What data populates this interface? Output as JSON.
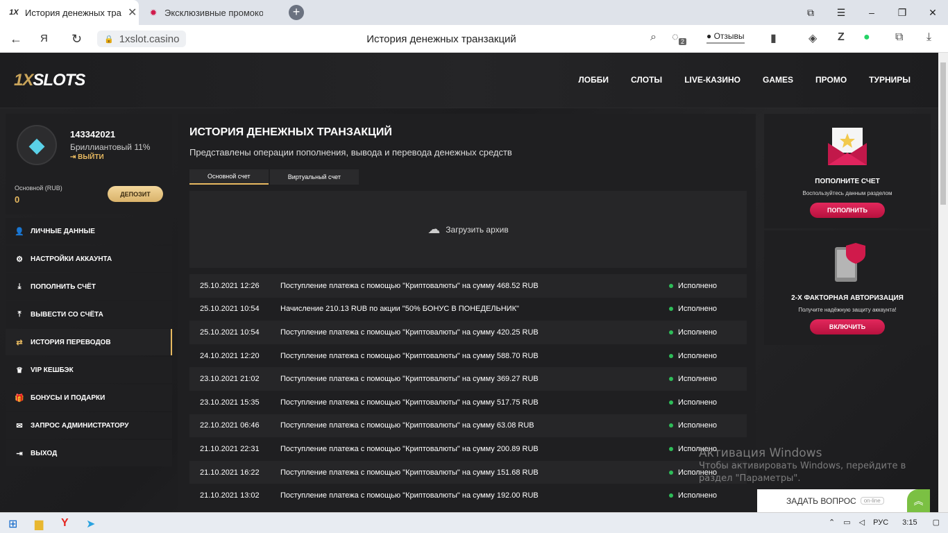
{
  "browser": {
    "tabs": [
      {
        "title": "История денежных тра",
        "favicon": "1X"
      },
      {
        "title": "Эксклюзивные промокод",
        "favicon": "✹"
      }
    ],
    "new_tab": "+",
    "url": "1xslot.casino",
    "page_title": "История денежных транзакций",
    "reviews_label": "Отзывы",
    "badge_count": "2"
  },
  "site": {
    "logo_prefix": "1X",
    "logo_rest": "SLOTS",
    "nav": [
      "ЛОББИ",
      "СЛОТЫ",
      "LIVE-КАЗИНО",
      "GAMES",
      "ПРОМО",
      "ТУРНИРЫ"
    ]
  },
  "profile": {
    "user_id": "143342021",
    "level": "Бриллиантовый 11%",
    "logout": "ВЫЙТИ",
    "balance_label": "Основной (RUB)",
    "balance_value": "0",
    "deposit_button": "ДЕПОЗИТ"
  },
  "menu": [
    {
      "label": "ЛИЧНЫЕ ДАННЫЕ",
      "icon": "user-icon",
      "glyph": "👤"
    },
    {
      "label": "НАСТРОЙКИ АККАУНТА",
      "icon": "gear-icon",
      "glyph": "⚙"
    },
    {
      "label": "ПОПОЛНИТЬ СЧЁТ",
      "icon": "download-icon",
      "glyph": "⤓"
    },
    {
      "label": "ВЫВЕСТИ СО СЧЁТА",
      "icon": "upload-icon",
      "glyph": "⤒"
    },
    {
      "label": "ИСТОРИЯ ПЕРЕВОДОВ",
      "icon": "transfer-icon",
      "glyph": "⇄"
    },
    {
      "label": "VIP КЕШБЭК",
      "icon": "crown-icon",
      "glyph": "♛"
    },
    {
      "label": "БОНУСЫ И ПОДАРКИ",
      "icon": "gift-icon",
      "glyph": "🎁"
    },
    {
      "label": "ЗАПРОС АДМИНИСТРАТОРУ",
      "icon": "mail-icon",
      "glyph": "✉"
    },
    {
      "label": "ВЫХОД",
      "icon": "exit-icon",
      "glyph": "⇥"
    }
  ],
  "content": {
    "title": "ИСТОРИЯ ДЕНЕЖНЫХ ТРАНЗАКЦИЙ",
    "subtitle": "Представлены операции пополнения, вывода и перевода денежных средств",
    "tabs": [
      "Основной счет",
      "Виртуальный счет"
    ],
    "archive_label": "Загрузить архив",
    "transactions": [
      {
        "date": "25.10.2021 12:26",
        "desc": "Поступление платежа с помощью \"Криптовалюты\" на сумму 468.52 RUB",
        "status": "Исполнено"
      },
      {
        "date": "25.10.2021 10:54",
        "desc": "Начисление 210.13 RUB по акции \"50% БОНУС В ПОНЕДЕЛЬНИК\"",
        "status": "Исполнено"
      },
      {
        "date": "25.10.2021 10:54",
        "desc": "Поступление платежа с помощью \"Криптовалюты\" на сумму 420.25 RUB",
        "status": "Исполнено"
      },
      {
        "date": "24.10.2021 12:20",
        "desc": "Поступление платежа с помощью \"Криптовалюты\" на сумму 588.70 RUB",
        "status": "Исполнено"
      },
      {
        "date": "23.10.2021 21:02",
        "desc": "Поступление платежа с помощью \"Криптовалюты\" на сумму 369.27 RUB",
        "status": "Исполнено"
      },
      {
        "date": "23.10.2021 15:35",
        "desc": "Поступление платежа с помощью \"Криптовалюты\" на сумму 517.75 RUB",
        "status": "Исполнено"
      },
      {
        "date": "22.10.2021 06:46",
        "desc": "Поступление платежа с помощью \"Криптовалюты\" на сумму 63.08 RUB",
        "status": "Исполнено"
      },
      {
        "date": "21.10.2021 22:31",
        "desc": "Поступление платежа с помощью \"Криптовалюты\" на сумму 200.89 RUB",
        "status": "Исполнено"
      },
      {
        "date": "21.10.2021 16:22",
        "desc": "Поступление платежа с помощью \"Криптовалюты\" на сумму 151.68 RUB",
        "status": "Исполнено"
      },
      {
        "date": "21.10.2021 13:02",
        "desc": "Поступление платежа с помощью \"Криптовалюты\" на сумму 192.00 RUB",
        "status": "Исполнено"
      }
    ]
  },
  "promos": [
    {
      "title": "ПОПОЛНИТЕ СЧЕТ",
      "subtitle": "Воспользуйтесь данным разделом",
      "button": "ПОПОЛНИТЬ"
    },
    {
      "title": "2-Х ФАКТОРНАЯ АВТОРИЗАЦИЯ",
      "subtitle": "Получите надёжную защиту аккаунта!",
      "button": "ВКЛЮЧИТЬ"
    }
  ],
  "watermark": {
    "line1": "Активация Windows",
    "line2": "Чтобы активировать Windows, перейдите в раздел \"Параметры\"."
  },
  "chat": {
    "label": "ЗАДАТЬ ВОПРОС",
    "status": "on-line"
  },
  "taskbar": {
    "lang": "РУС",
    "time": "3:15"
  },
  "colors": {
    "accent_gold": "#e7b960",
    "accent_red": "#d01a4b",
    "status_green": "#2ebd59"
  }
}
